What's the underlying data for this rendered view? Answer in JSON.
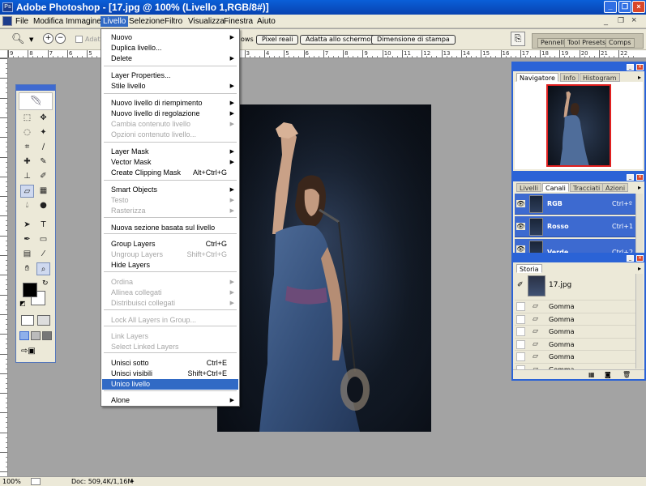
{
  "app": {
    "title": "Adobe Photoshop - [17.jpg @ 100% (Livello 1,RGB/8#)]"
  },
  "menubar": [
    "File",
    "Modifica",
    "Immagine",
    "Livello",
    "Selezione",
    "Filtro",
    "Visualizza",
    "Finestra",
    "Aiuto"
  ],
  "options": {
    "adatta": "Adatta",
    "ows": "ows",
    "btn1": "Pixel reali",
    "btn2": "Adatta allo schermo",
    "btn3": "Dimensione di stampa",
    "well_tabs": [
      "Pennelli",
      "Tool Presets",
      "Comps"
    ]
  },
  "ruler": {
    "h": [
      "9",
      "8",
      "7",
      "6",
      "5",
      "4",
      "3",
      "2",
      "1",
      "0",
      "1",
      "2",
      "3",
      "4",
      "5",
      "6",
      "7",
      "8",
      "9",
      "10",
      "11",
      "12",
      "13",
      "14",
      "15",
      "16",
      "17",
      "18",
      "19",
      "20",
      "21",
      "22"
    ]
  },
  "status": {
    "zoom": "100%",
    "doc": "Doc: 509,4K/1,16M"
  },
  "menu": {
    "items": [
      {
        "label": "Nuovo",
        "shortcut": "",
        "sub": true,
        "dis": false
      },
      {
        "label": "Duplica livello...",
        "shortcut": "",
        "sub": false,
        "dis": false
      },
      {
        "label": "Delete",
        "shortcut": "",
        "sub": true,
        "dis": false
      },
      {
        "label": "Layer Properties...",
        "shortcut": "",
        "sub": false,
        "dis": false
      },
      {
        "label": "Stile livello",
        "shortcut": "",
        "sub": true,
        "dis": false
      },
      {
        "label": "Nuovo livello di riempimento",
        "shortcut": "",
        "sub": true,
        "dis": false
      },
      {
        "label": "Nuovo livello di regolazione",
        "shortcut": "",
        "sub": true,
        "dis": false
      },
      {
        "label": "Cambia contenuto livello",
        "shortcut": "",
        "sub": true,
        "dis": true
      },
      {
        "label": "Opzioni contenuto livello...",
        "shortcut": "",
        "sub": false,
        "dis": true
      },
      {
        "label": "Layer Mask",
        "shortcut": "",
        "sub": true,
        "dis": false
      },
      {
        "label": "Vector Mask",
        "shortcut": "",
        "sub": true,
        "dis": false
      },
      {
        "label": "Create Clipping Mask",
        "shortcut": "Alt+Ctrl+G",
        "sub": false,
        "dis": false
      },
      {
        "label": "Smart Objects",
        "shortcut": "",
        "sub": true,
        "dis": false
      },
      {
        "label": "Testo",
        "shortcut": "",
        "sub": true,
        "dis": true
      },
      {
        "label": "Rasterizza",
        "shortcut": "",
        "sub": true,
        "dis": true
      },
      {
        "label": "Nuova sezione basata sul livello",
        "shortcut": "",
        "sub": false,
        "dis": false
      },
      {
        "label": "Group Layers",
        "shortcut": "Ctrl+G",
        "sub": false,
        "dis": false
      },
      {
        "label": "Ungroup Layers",
        "shortcut": "Shift+Ctrl+G",
        "sub": false,
        "dis": true
      },
      {
        "label": "Hide Layers",
        "shortcut": "",
        "sub": false,
        "dis": false
      },
      {
        "label": "Ordina",
        "shortcut": "",
        "sub": true,
        "dis": true
      },
      {
        "label": "Allinea collegati",
        "shortcut": "",
        "sub": true,
        "dis": true
      },
      {
        "label": "Distribuisci collegati",
        "shortcut": "",
        "sub": true,
        "dis": true
      },
      {
        "label": "Lock All Layers in Group...",
        "shortcut": "",
        "sub": false,
        "dis": true
      },
      {
        "label": "Link Layers",
        "shortcut": "",
        "sub": false,
        "dis": true
      },
      {
        "label": "Select Linked Layers",
        "shortcut": "",
        "sub": false,
        "dis": true
      },
      {
        "label": "Unisci sotto",
        "shortcut": "Ctrl+E",
        "sub": false,
        "dis": false
      },
      {
        "label": "Unisci visibili",
        "shortcut": "Shift+Ctrl+E",
        "sub": false,
        "dis": false
      },
      {
        "label": "Unico livello",
        "shortcut": "",
        "sub": false,
        "dis": false,
        "hl": true
      },
      {
        "label": "Alone",
        "shortcut": "",
        "sub": true,
        "dis": false
      }
    ]
  },
  "navigator": {
    "tabs": [
      "Navigatore",
      "Info",
      "Histogram"
    ]
  },
  "layers": {
    "tabs": [
      "Livelli",
      "Canali",
      "Tracciati",
      "Azioni"
    ],
    "channels": [
      {
        "name": "RGB",
        "sc": "Ctrl+º"
      },
      {
        "name": "Rosso",
        "sc": "Ctrl+1"
      },
      {
        "name": "Verde",
        "sc": "Ctrl+2"
      }
    ]
  },
  "history": {
    "tab": "Storia",
    "snapshot": "17.jpg",
    "steps": [
      "Gomma",
      "Gomma",
      "Gomma",
      "Gomma",
      "Gomma",
      "Gomma"
    ]
  },
  "colors": {
    "xp_blue": "#2b63d6",
    "menu_hl": "#316ac5"
  }
}
